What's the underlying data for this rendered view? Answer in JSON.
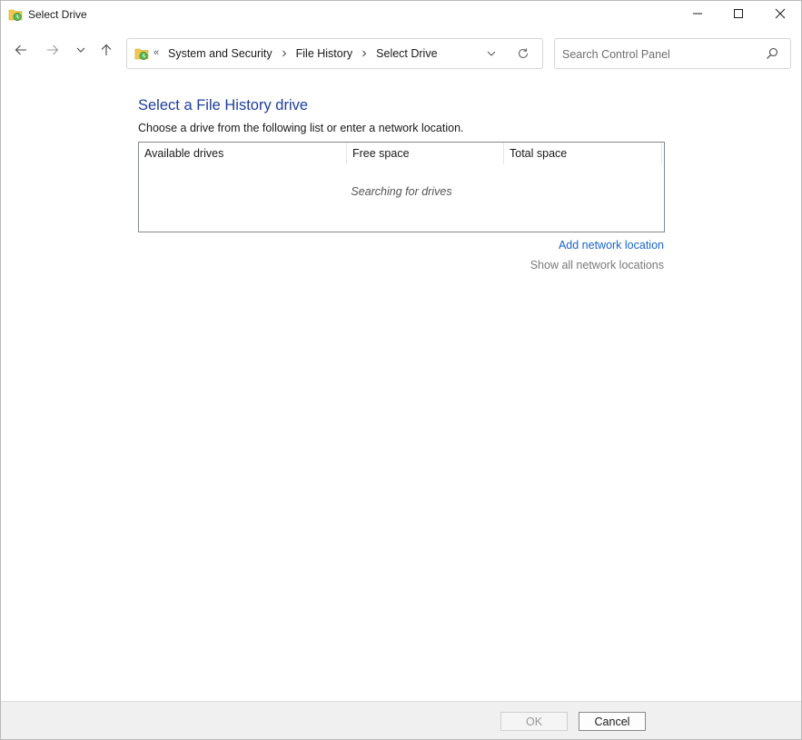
{
  "window": {
    "title": "Select Drive"
  },
  "address_bar": {
    "overflow": "«",
    "crumbs": [
      "System and Security",
      "File History",
      "Select Drive"
    ]
  },
  "search": {
    "placeholder": "Search Control Panel",
    "value": ""
  },
  "main": {
    "heading": "Select a File History drive",
    "instruction": "Choose a drive from the following list or enter a network location.",
    "drive_list": {
      "columns": [
        "Available drives",
        "Free space",
        "Total space"
      ],
      "status": "Searching for drives"
    },
    "links": {
      "add_network": "Add network location",
      "show_all": "Show all network locations"
    }
  },
  "footer": {
    "ok_label": "OK",
    "cancel_label": "Cancel"
  },
  "colors": {
    "heading": "#1e3e9a",
    "link": "#1a64c8",
    "disabled_link": "#7a7a7a"
  },
  "icons": {
    "app": "file-history-icon",
    "minimize": "minimize-icon",
    "maximize": "maximize-icon",
    "close": "close-icon",
    "back": "arrow-left-icon",
    "forward": "arrow-right-icon",
    "recent": "chevron-down-icon",
    "up": "arrow-up-icon",
    "dropdown": "chevron-down-icon",
    "refresh": "refresh-icon",
    "search": "search-icon"
  }
}
